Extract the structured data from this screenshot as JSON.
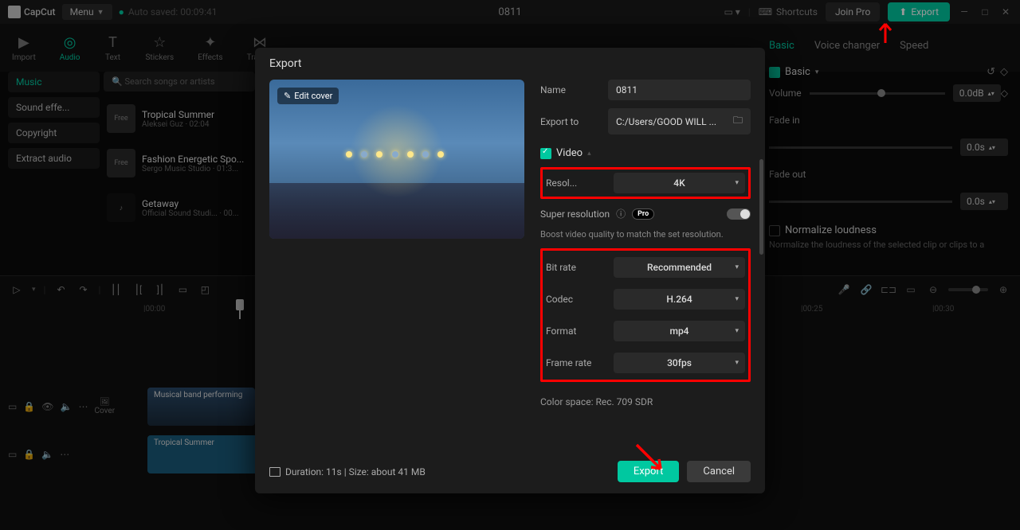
{
  "topbar": {
    "app": "CapCut",
    "menu": "Menu",
    "autosaved": "Auto saved: 00:09:41",
    "title": "0811",
    "shortcuts": "Shortcuts",
    "join_pro": "Join Pro",
    "export": "Export"
  },
  "tools": {
    "import": "Import",
    "audio": "Audio",
    "text": "Text",
    "stickers": "Stickers",
    "effects": "Effects",
    "trans": "Trans..."
  },
  "left": {
    "music": "Music",
    "soundeff": "Sound effe...",
    "copyright": "Copyright",
    "extract": "Extract audio"
  },
  "search_placeholder": "Search songs or artists",
  "songs": [
    {
      "title": "Tropical Summer",
      "sub": "Aleksei Guz · 02:04",
      "badge": "Free"
    },
    {
      "title": "Fashion Energetic Spo...",
      "sub": "Sergo Music Studio · 01:3...",
      "badge": "Free"
    },
    {
      "title": "Getaway",
      "sub": "Official Sound Studi... · 00...",
      "badge": ""
    }
  ],
  "right": {
    "tabs": {
      "basic": "Basic",
      "voice": "Voice changer",
      "speed": "Speed"
    },
    "basic_hdr": "Basic",
    "volume": "Volume",
    "volume_val": "0.0dB",
    "fadein": "Fade in",
    "fadein_val": "0.0s",
    "fadeout": "Fade out",
    "fadeout_val": "0.0s",
    "normalize": "Normalize loudness",
    "normalize_desc": "Normalize the loudness of the selected clip or clips to a"
  },
  "timeline": {
    "t1": "|00:00",
    "t2": "|00:25",
    "t3": "|00:30",
    "clip_video": "Musical band performing",
    "clip_audio": "Tropical Summer",
    "cover": "Cover"
  },
  "modal": {
    "title": "Export",
    "edit_cover": "Edit cover",
    "name_label": "Name",
    "name_val": "0811",
    "exportto_label": "Export to",
    "exportto_val": "C:/Users/GOOD WILL ...",
    "video_hdr": "Video",
    "resol_label": "Resol...",
    "resol_val": "4K",
    "super_label": "Super resolution",
    "pro": "Pro",
    "super_hint": "Boost video quality to match the set resolution.",
    "bitrate_label": "Bit rate",
    "bitrate_val": "Recommended",
    "codec_label": "Codec",
    "codec_val": "H.264",
    "format_label": "Format",
    "format_val": "mp4",
    "fps_label": "Frame rate",
    "fps_val": "30fps",
    "colorspace": "Color space: Rec. 709 SDR",
    "duration": "Duration: 11s | Size: about 41 MB",
    "export": "Export",
    "cancel": "Cancel"
  }
}
